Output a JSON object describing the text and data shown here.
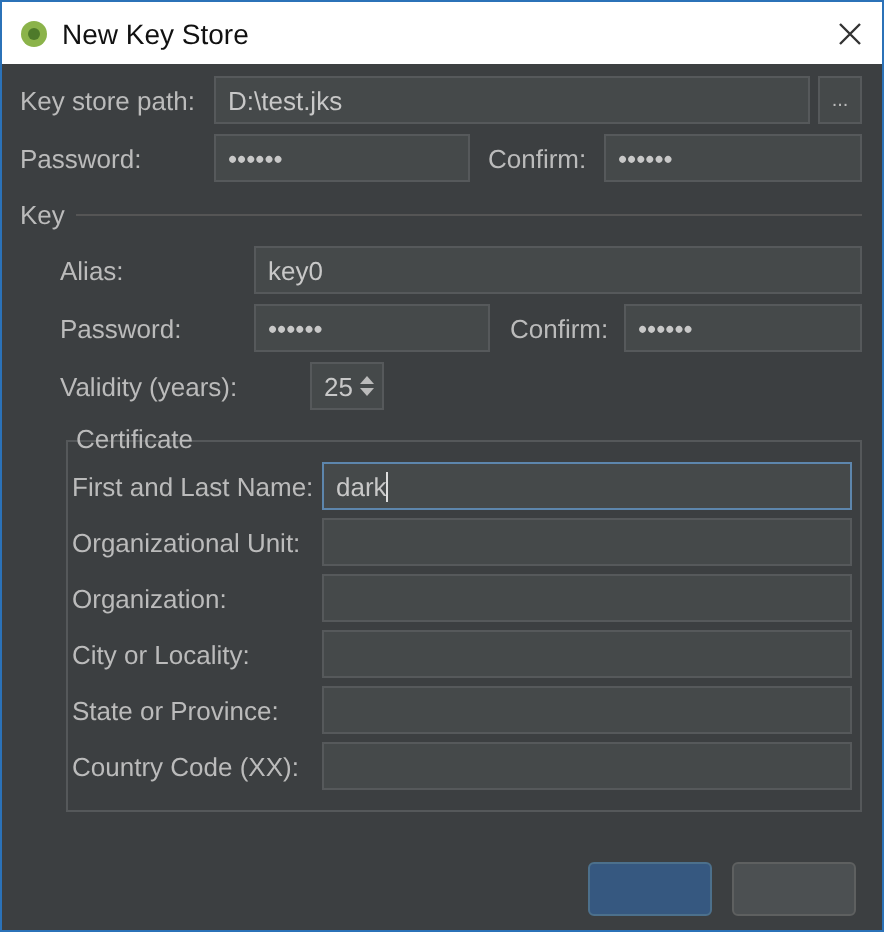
{
  "window": {
    "title": "New Key Store"
  },
  "keystore": {
    "path_label": "Key store path:",
    "path": "D:\\test.jks",
    "browse": "...",
    "password_label": "Password:",
    "password": "••••••",
    "confirm_label": "Confirm:",
    "confirm": "••••••"
  },
  "key": {
    "title": "Key",
    "alias_label": "Alias:",
    "alias": "key0",
    "password_label": "Password:",
    "password": "••••••",
    "confirm_label": "Confirm:",
    "confirm": "••••••",
    "validity_label": "Validity (years):",
    "validity": "25",
    "certificate": {
      "title": "Certificate",
      "fields": [
        {
          "label": "First and Last Name:",
          "value": "dark",
          "focused": true
        },
        {
          "label": "Organizational Unit:",
          "focused": false
        },
        {
          "label": "Organization:",
          "focused": false
        },
        {
          "label": "City or Locality:",
          "focused": false
        },
        {
          "label": "State or Province:",
          "focused": false
        },
        {
          "label": "Country Code (XX):",
          "focused": false
        }
      ]
    }
  },
  "buttons": [
    {
      "kind": "primary"
    },
    {
      "kind": "default"
    }
  ]
}
